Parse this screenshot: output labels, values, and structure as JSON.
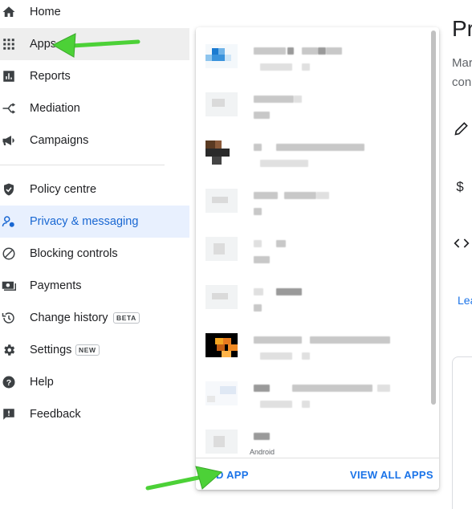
{
  "sidebar": {
    "items": [
      {
        "label": "Home",
        "icon": "home-icon"
      },
      {
        "label": "Apps",
        "icon": "apps-grid-icon"
      },
      {
        "label": "Reports",
        "icon": "reports-icon"
      },
      {
        "label": "Mediation",
        "icon": "mediation-icon"
      },
      {
        "label": "Campaigns",
        "icon": "campaigns-icon"
      },
      {
        "label": "Policy centre",
        "icon": "shield-icon"
      },
      {
        "label": "Privacy & messaging",
        "icon": "privacy-icon"
      },
      {
        "label": "Blocking controls",
        "icon": "blocking-icon"
      },
      {
        "label": "Payments",
        "icon": "payments-icon"
      },
      {
        "label": "Change history",
        "icon": "history-icon",
        "badge": "BETA"
      },
      {
        "label": "Settings",
        "icon": "gear-icon",
        "badge": "NEW"
      },
      {
        "label": "Help",
        "icon": "help-icon"
      },
      {
        "label": "Feedback",
        "icon": "feedback-icon"
      }
    ],
    "active_item": "Privacy & messaging",
    "hover_item": "Apps"
  },
  "page": {
    "title_fragment": "Pr",
    "subtitle_line1_fragment": "Mar",
    "subtitle_line2_fragment": "con",
    "learn_link_fragment": "Lea"
  },
  "app_picker": {
    "add_app_visible_label": "D APP",
    "view_all_label": "VIEW ALL APPS",
    "last_row_platform_fragment": "Android"
  },
  "colors": {
    "accent": "#1a73e8",
    "active_bg": "#e8f0fe",
    "annotation_arrow": "#4cd137"
  }
}
